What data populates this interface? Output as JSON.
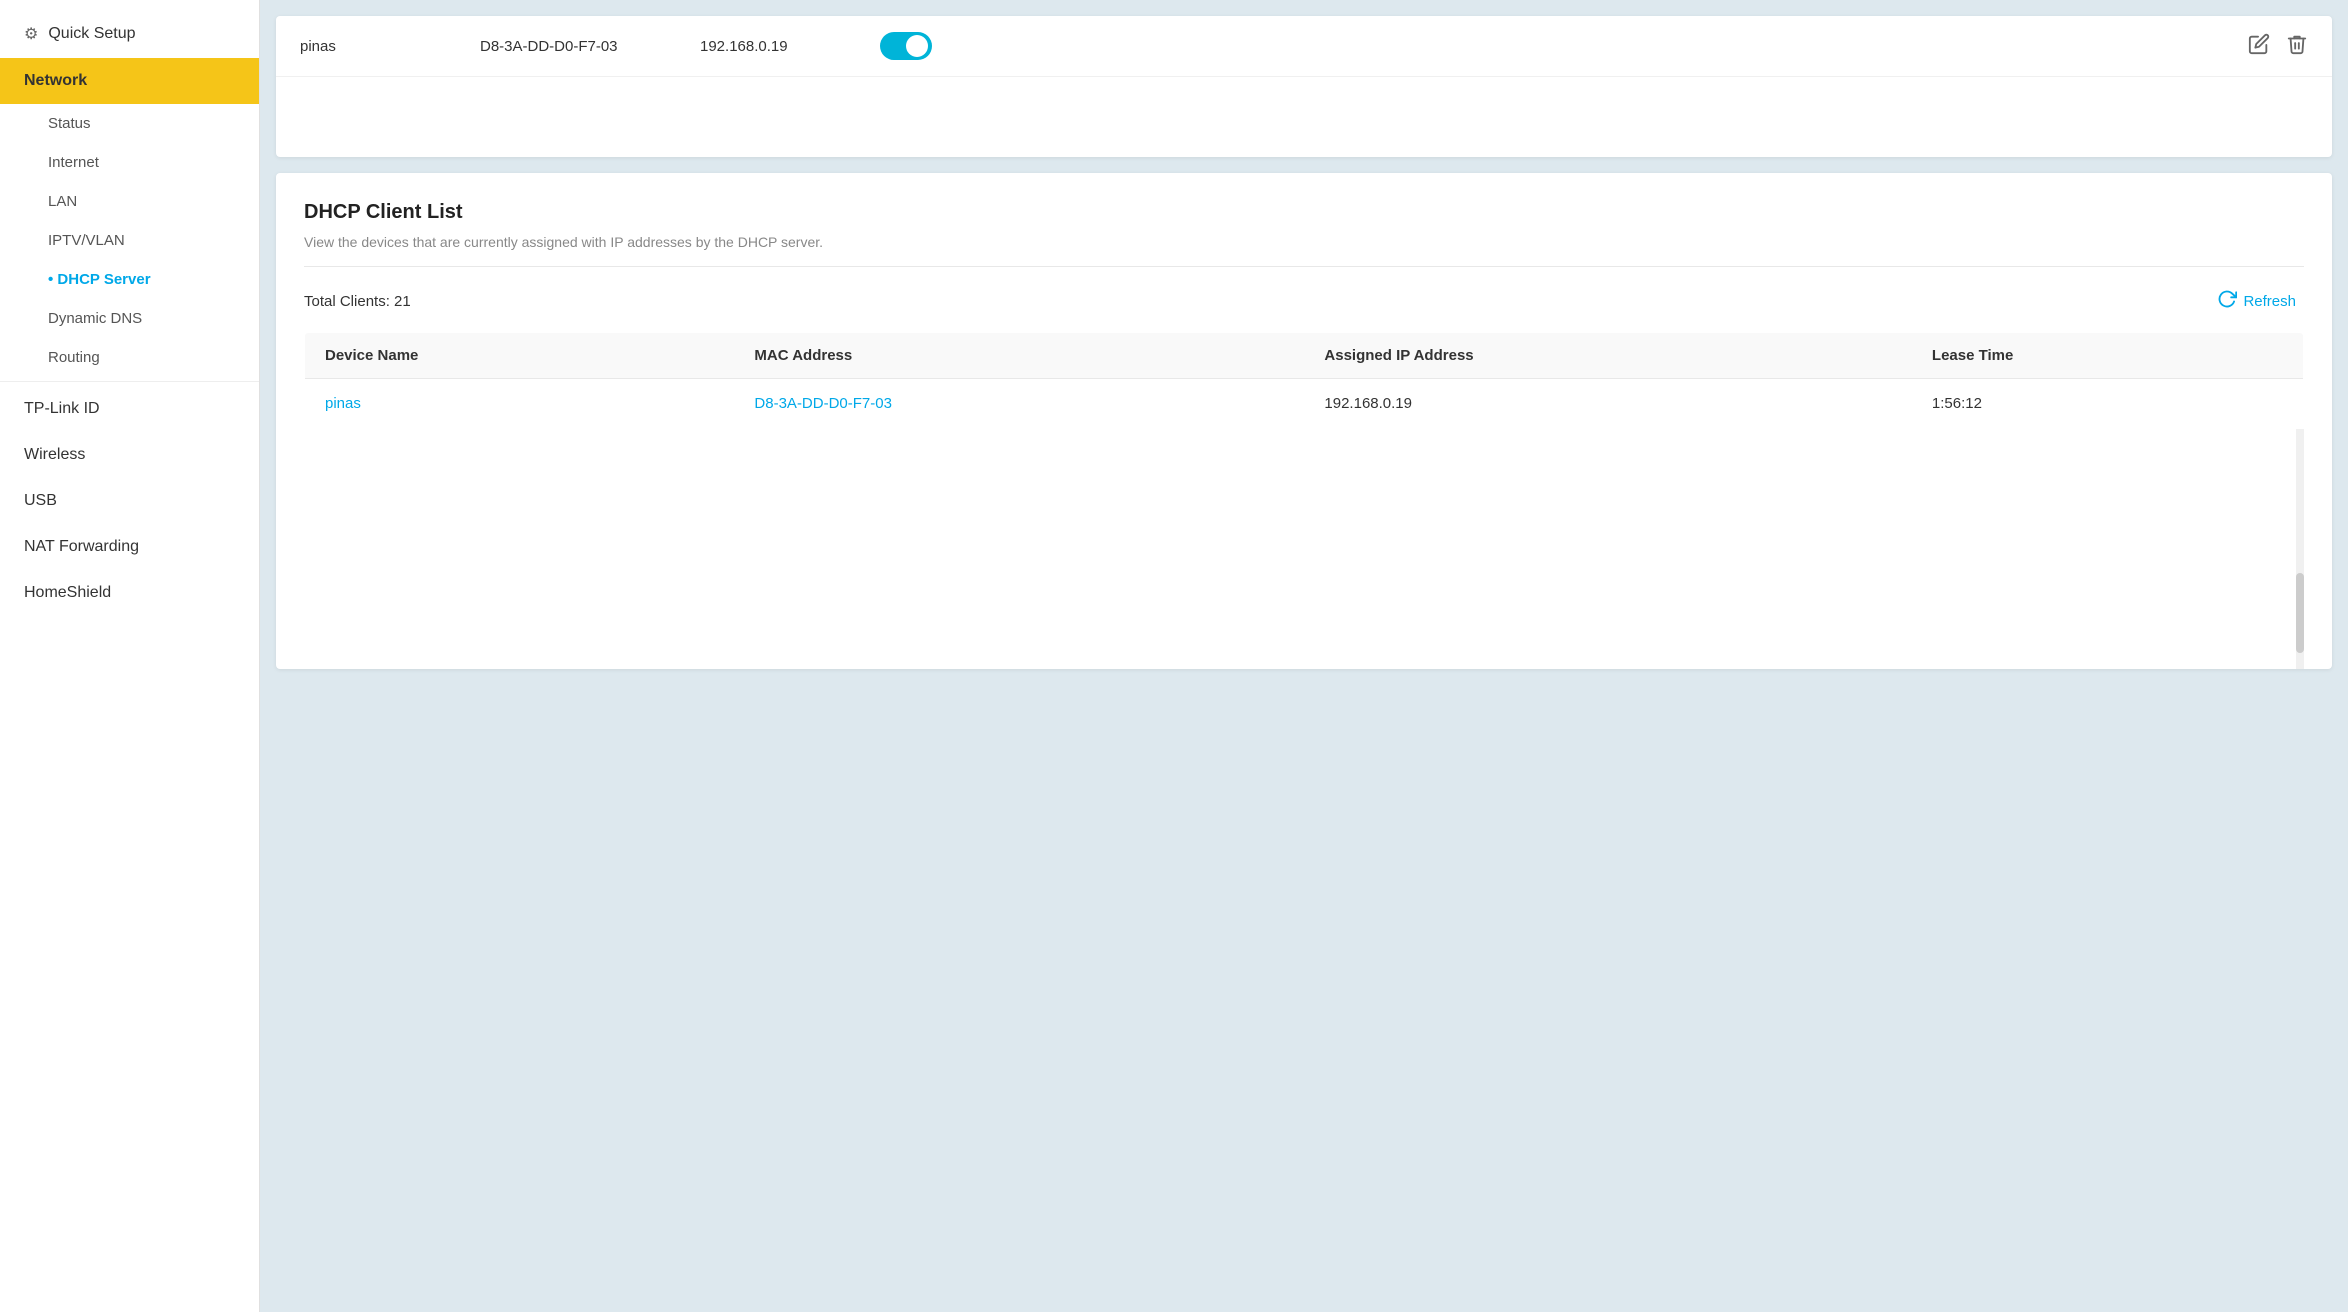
{
  "sidebar": {
    "quickSetup": {
      "label": "Quick Setup",
      "icon": "⚙"
    },
    "network": {
      "label": "Network",
      "active": true,
      "subItems": [
        {
          "id": "status",
          "label": "Status",
          "active": false,
          "dot": false
        },
        {
          "id": "internet",
          "label": "Internet",
          "active": false,
          "dot": false
        },
        {
          "id": "lan",
          "label": "LAN",
          "active": false,
          "dot": false
        },
        {
          "id": "iptv",
          "label": "IPTV/VLAN",
          "active": false,
          "dot": false
        },
        {
          "id": "dhcp",
          "label": "DHCP Server",
          "active": true,
          "dot": true
        },
        {
          "id": "ddns",
          "label": "Dynamic DNS",
          "active": false,
          "dot": false
        },
        {
          "id": "routing",
          "label": "Routing",
          "active": false,
          "dot": false
        }
      ]
    },
    "tpLinkId": {
      "label": "TP-Link ID"
    },
    "wireless": {
      "label": "Wireless"
    },
    "usb": {
      "label": "USB"
    },
    "natForwarding": {
      "label": "NAT Forwarding"
    },
    "homeShield": {
      "label": "HomeShield"
    }
  },
  "staticBinding": {
    "row": {
      "deviceName": "pinas",
      "macAddress": "D8-3A-DD-D0-F7-03",
      "ipAddress": "192.168.0.19",
      "enabled": true
    }
  },
  "dhcpClientList": {
    "title": "DHCP Client List",
    "description": "View the devices that are currently assigned with IP addresses by the DHCP server.",
    "totalClientsLabel": "Total Clients:",
    "totalClientsCount": "21",
    "refreshLabel": "Refresh",
    "table": {
      "headers": [
        "Device Name",
        "MAC Address",
        "Assigned IP Address",
        "Lease Time"
      ],
      "rows": [
        {
          "deviceName": "pinas",
          "macAddress": "D8-3A-DD-D0-F7-03",
          "assignedIp": "192.168.0.19",
          "leaseTime": "1:56:12"
        }
      ]
    }
  },
  "colors": {
    "accent": "#00a8e8",
    "sidebarActive": "#f5c518",
    "toggleOn": "#00b4d8"
  }
}
